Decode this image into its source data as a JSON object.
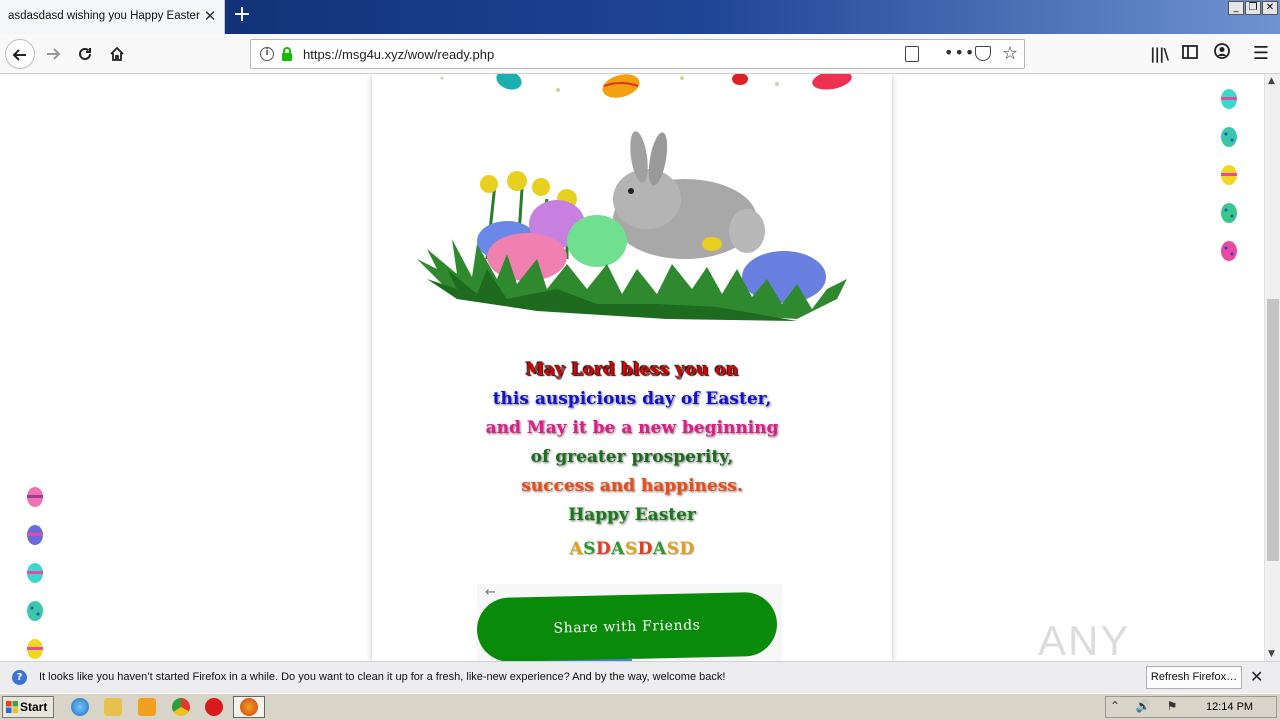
{
  "browser": {
    "tab_title": "asdasdasd wishing you Happy Easter",
    "tab_close": "✕",
    "new_tab": "+",
    "url": "https://msg4u.xyz/wow/ready.php",
    "url_host_highlight": "msg4u.xyz",
    "more_label": "•••",
    "star": "☆",
    "menu": "☰",
    "window_min": "_",
    "window_max": "❐",
    "window_close": "✕",
    "icons": [
      "back-arrow-icon",
      "forward-arrow-icon",
      "reload-icon",
      "home-icon",
      "info-icon",
      "lock-icon",
      "reader-view-icon",
      "pocket-icon",
      "bookmark-star-icon",
      "library-icon",
      "sidebar-icon",
      "account-icon",
      "hamburger-menu-icon"
    ]
  },
  "card": {
    "lines": [
      "May Lord bless you on",
      "this auspicious day of Easter,",
      "and May it be a new beginning",
      "of greater prosperity,",
      "success and happiness.",
      "Happy Easter"
    ],
    "sender_letters": [
      "A",
      "S",
      "D",
      "A",
      "S",
      "D",
      "A",
      "S",
      "D"
    ],
    "sender_colors": [
      "#e0a020",
      "#2a9a2a",
      "#e04020",
      "#2a9a2a",
      "#e0a020",
      "#e04020",
      "#2a9a2a",
      "#e0a020",
      "#e0a020"
    ],
    "share_back": "←",
    "share_button": "Share with Friends"
  },
  "colors": {
    "share_green": "#0a8a0a",
    "line_colors": [
      "#e00000",
      "#1010d8",
      "#e21a8a",
      "#1e6a1e",
      "#ee4b16",
      "#1a7a1a"
    ]
  },
  "watermark": {
    "text": "ANY RUN"
  },
  "notification": {
    "icon": "?",
    "text": "It looks like you haven’t started Firefox in a while. Do you want to clean it up for a fresh, like-new experience? And by the way, welcome back!",
    "refresh_label": "Refresh Firefox…",
    "close": "✕"
  },
  "taskbar": {
    "start_label": "Start",
    "clock": "12:14 PM",
    "tray_icons": "⌃ 🔊 ⚑"
  }
}
